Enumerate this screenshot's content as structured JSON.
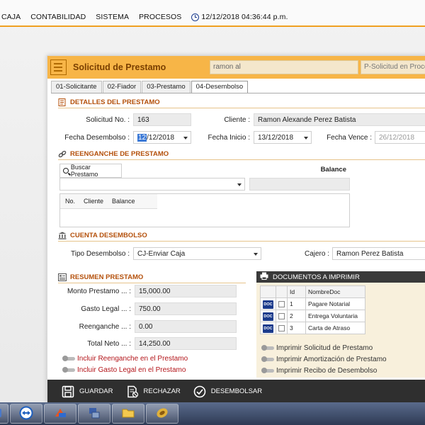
{
  "menubar": {
    "items": [
      "CAJA",
      "CONTABILIDAD",
      "SISTEMA",
      "PROCESOS"
    ],
    "clock": "12/12/2018 04:36:44 p.m."
  },
  "form": {
    "title": "Solicitud de Prestamo",
    "user": "ramon al",
    "status": "P-Solicitud en Proce",
    "tabs": [
      "01-Solicitante",
      "02-Fiador",
      "03-Prestamo",
      "04-Desembolso"
    ],
    "active_tab": "04-Desembolso"
  },
  "detalles": {
    "header": "DETALLES DEL PRESTAMO",
    "solicitud_label": "Solicitud No. :",
    "solicitud_value": "163",
    "cliente_label": "Cliente :",
    "cliente_value": "Ramon Alexande Perez Batista",
    "fecha_desembolso_label": "Fecha Desembolso :",
    "fecha_desembolso_sel": "12",
    "fecha_desembolso_rest": "/12/2018",
    "fecha_inicio_label": "Fecha Inicio :",
    "fecha_inicio_value": "13/12/2018",
    "fecha_vence_label": "Fecha Vence :",
    "fecha_vence_value": "26/12/2018"
  },
  "reenganche": {
    "header": "REENGANCHE DE PRESTAMO",
    "buscar_label": "Buscar Prestamo",
    "balance_label": "Balance",
    "columns": [
      "No.",
      "Cliente",
      "Balance"
    ]
  },
  "cuenta": {
    "header": "CUENTA DESEMBOLSO",
    "tipo_label": "Tipo Desembolso :",
    "tipo_value": "CJ-Enviar Caja",
    "cajero_label": "Cajero :",
    "cajero_value": "Ramon Perez Batista"
  },
  "resumen": {
    "header": "RESUMEN PRESTAMO",
    "rows": [
      {
        "label": "Monto Prestamo ... :",
        "value": "15,000.00"
      },
      {
        "label": "Gasto Legal ... :",
        "value": "750.00"
      },
      {
        "label": "Reenganche ... :",
        "value": "0.00"
      },
      {
        "label": "Total Neto ... :",
        "value": "14,250.00"
      }
    ],
    "options": [
      "Incluir Reenganche en el Prestamo",
      "Incluir Gasto Legal en el Prestamo"
    ]
  },
  "documentos": {
    "header": "DOCUMENTOS A IMPRIMIR",
    "columns": [
      "Id",
      "NombreDoc"
    ],
    "icon_text": "DOC",
    "rows": [
      {
        "id": "1",
        "name": "Pagare Notarial"
      },
      {
        "id": "2",
        "name": "Entrega Voluntaria"
      },
      {
        "id": "3",
        "name": "Carta de Atraso"
      }
    ],
    "options": [
      "Imprimir Solicitud de Prestamo",
      "Imprimir Amortización de Prestamo",
      "Imprimir Recibo de Desembolso"
    ]
  },
  "actions": {
    "guardar": "GUARDAR",
    "rechazar": "RECHAZAR",
    "desembolsar": "DESEMBOLSAR"
  },
  "colors": {
    "accent": "#f7b547",
    "section_text": "#b4500b",
    "action_bar": "#2f2f2f"
  }
}
